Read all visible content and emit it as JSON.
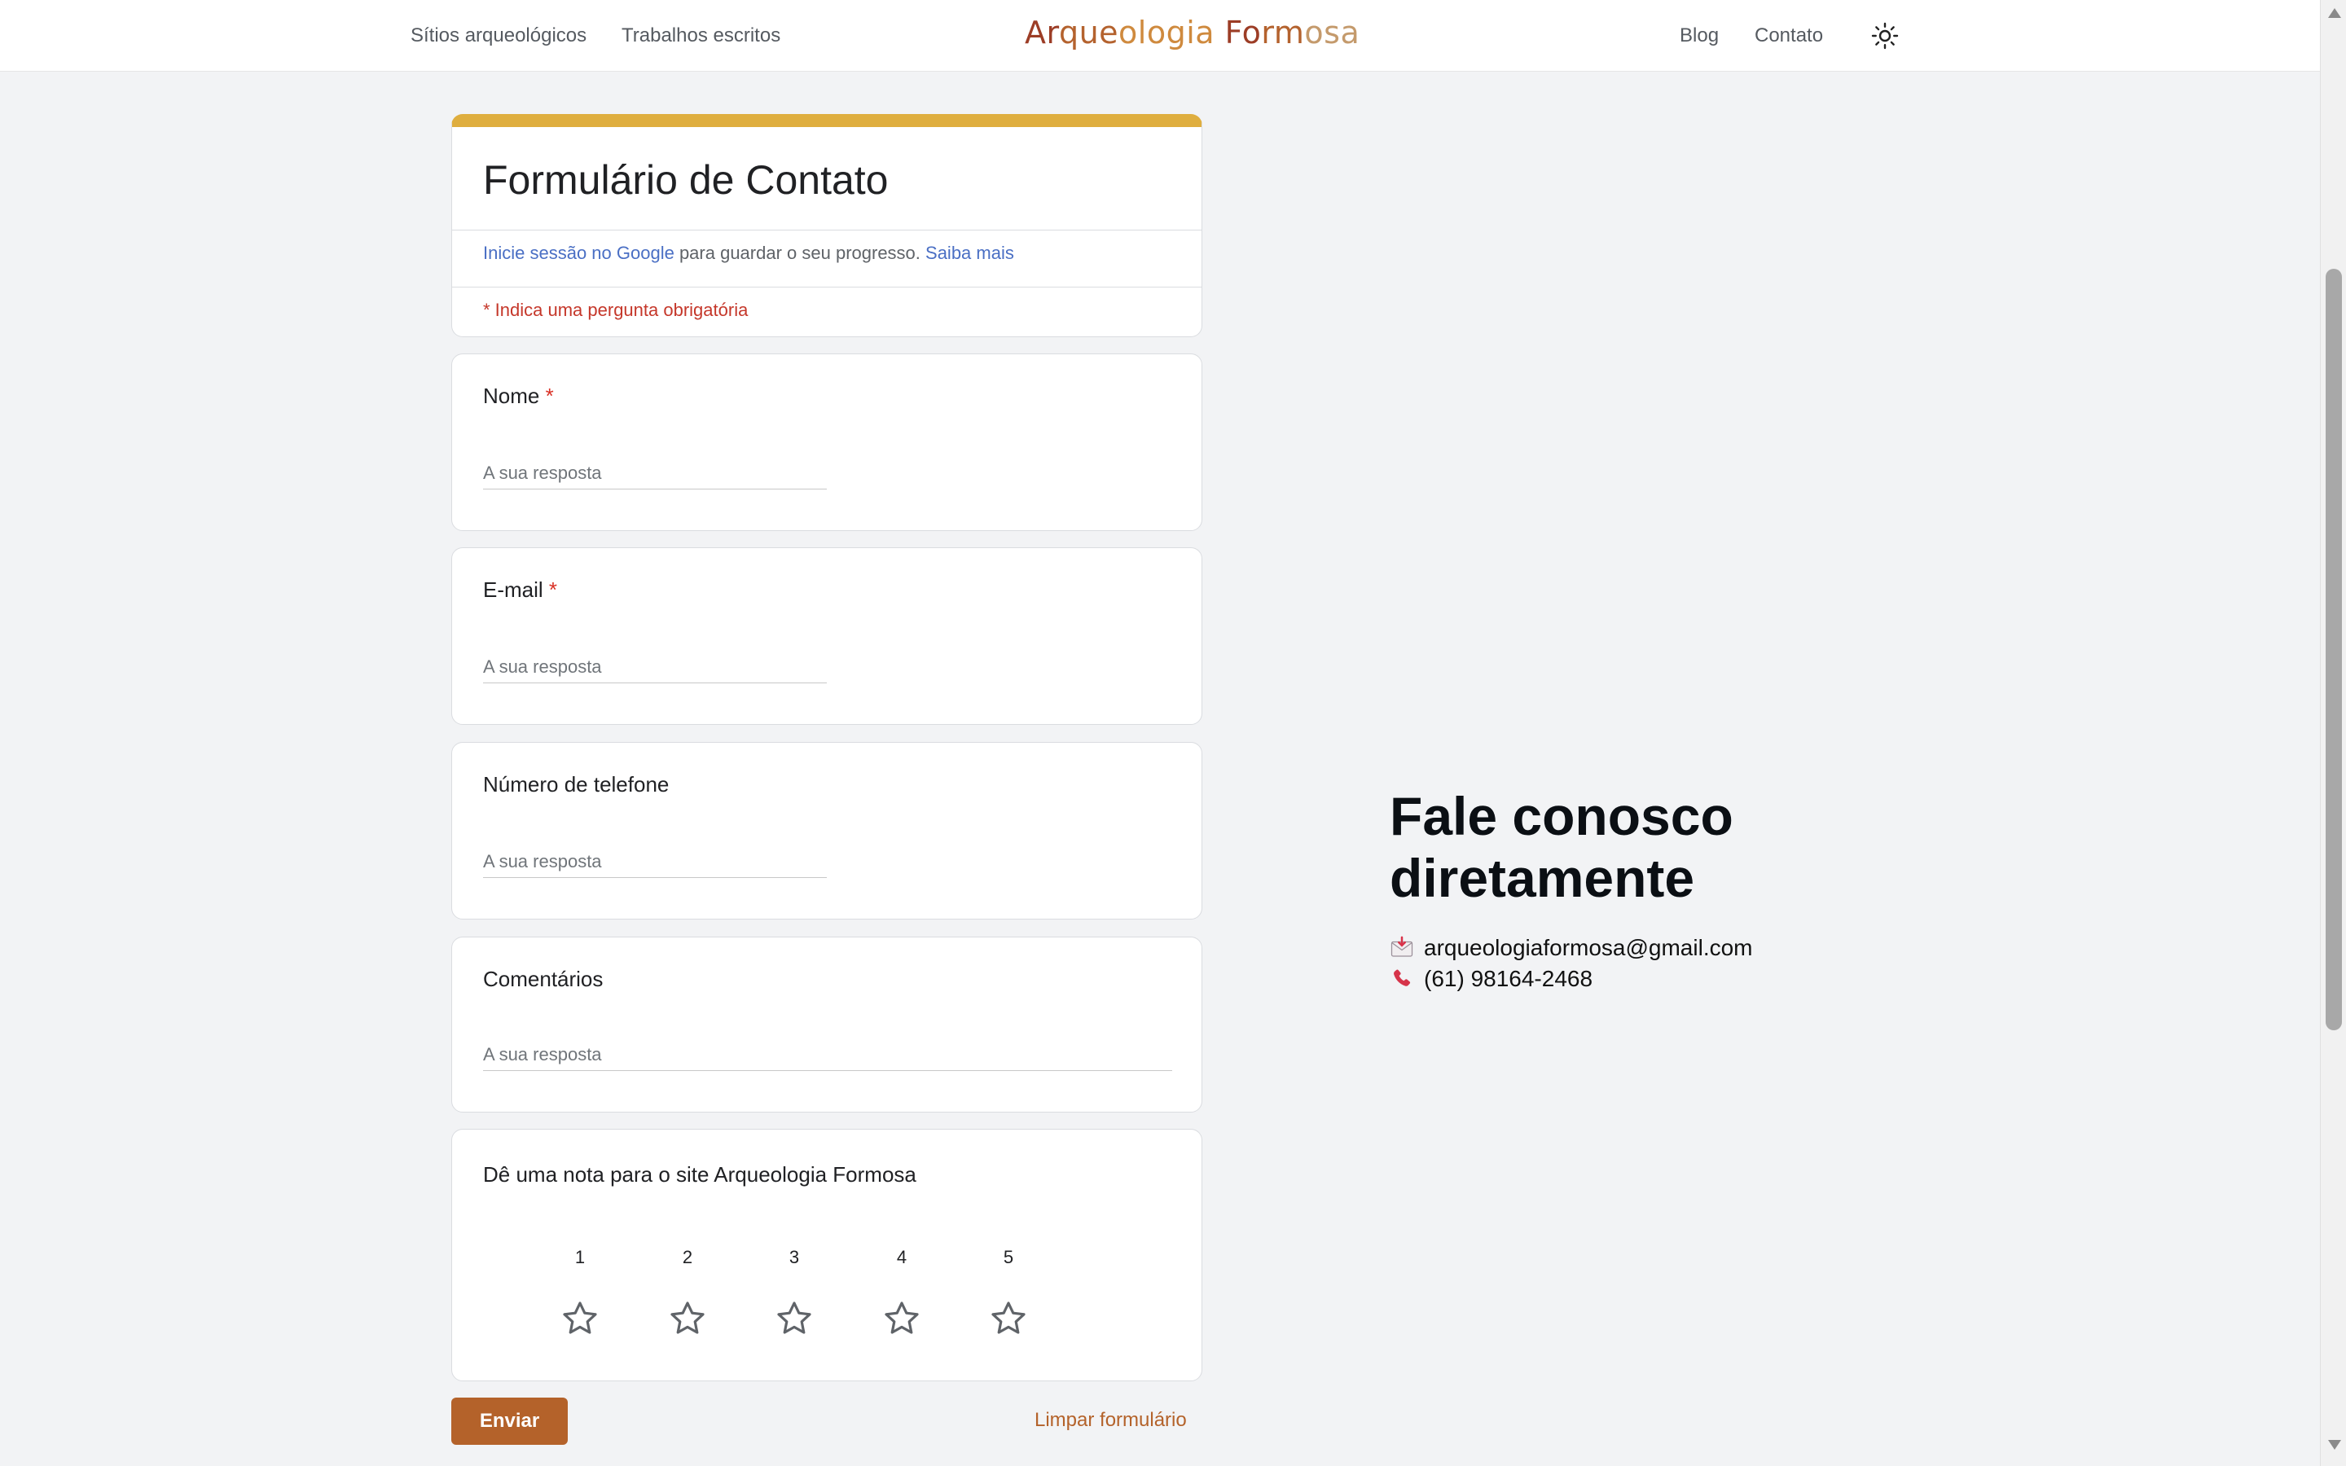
{
  "nav": {
    "left_links": [
      "Sítios arqueológicos",
      "Trabalhos escritos"
    ],
    "logo": {
      "parts": [
        {
          "text": "Ar",
          "color": "#9c3d26"
        },
        {
          "text": "que",
          "color": "#b4622e"
        },
        {
          "text": "ologia",
          "color": "#cf8a3e"
        },
        {
          "text": " Fo",
          "color": "#9c3d26"
        },
        {
          "text": "rm",
          "color": "#b4622e"
        },
        {
          "text": "osa",
          "color": "#c49a6c"
        }
      ]
    },
    "right_links": [
      "Blog",
      "Contato"
    ],
    "theme_icon": "sun-icon"
  },
  "form": {
    "title": "Formulário de Contato",
    "accent_color": "#dfae3f",
    "signin": {
      "link_text": "Inicie sessão no Google",
      "middle_text": " para guardar o seu progresso. ",
      "learn_more": "Saiba mais"
    },
    "required_note": "* Indica uma pergunta obrigatória",
    "questions": [
      {
        "label": "Nome",
        "required": "*",
        "placeholder": "A sua resposta"
      },
      {
        "label": "E-mail",
        "required": "*",
        "placeholder": "A sua resposta"
      },
      {
        "label": "Número de telefone",
        "placeholder": "A sua resposta"
      },
      {
        "label": "Comentários",
        "placeholder": "A sua resposta"
      }
    ],
    "rating": {
      "label": "Dê uma nota para o site Arqueologia Formosa",
      "options": [
        "1",
        "2",
        "3",
        "4",
        "5"
      ],
      "icon": "star-outline-icon"
    },
    "submit_label": "Enviar",
    "submit_color": "#b4622a",
    "clear_label": "Limpar formulário"
  },
  "contact": {
    "heading": "Fale conosco diretamente",
    "email": "arqueologiaformosa@gmail.com",
    "email_icon": "envelope-icon",
    "phone": "(61) 98164-2468",
    "phone_icon": "phone-icon"
  }
}
